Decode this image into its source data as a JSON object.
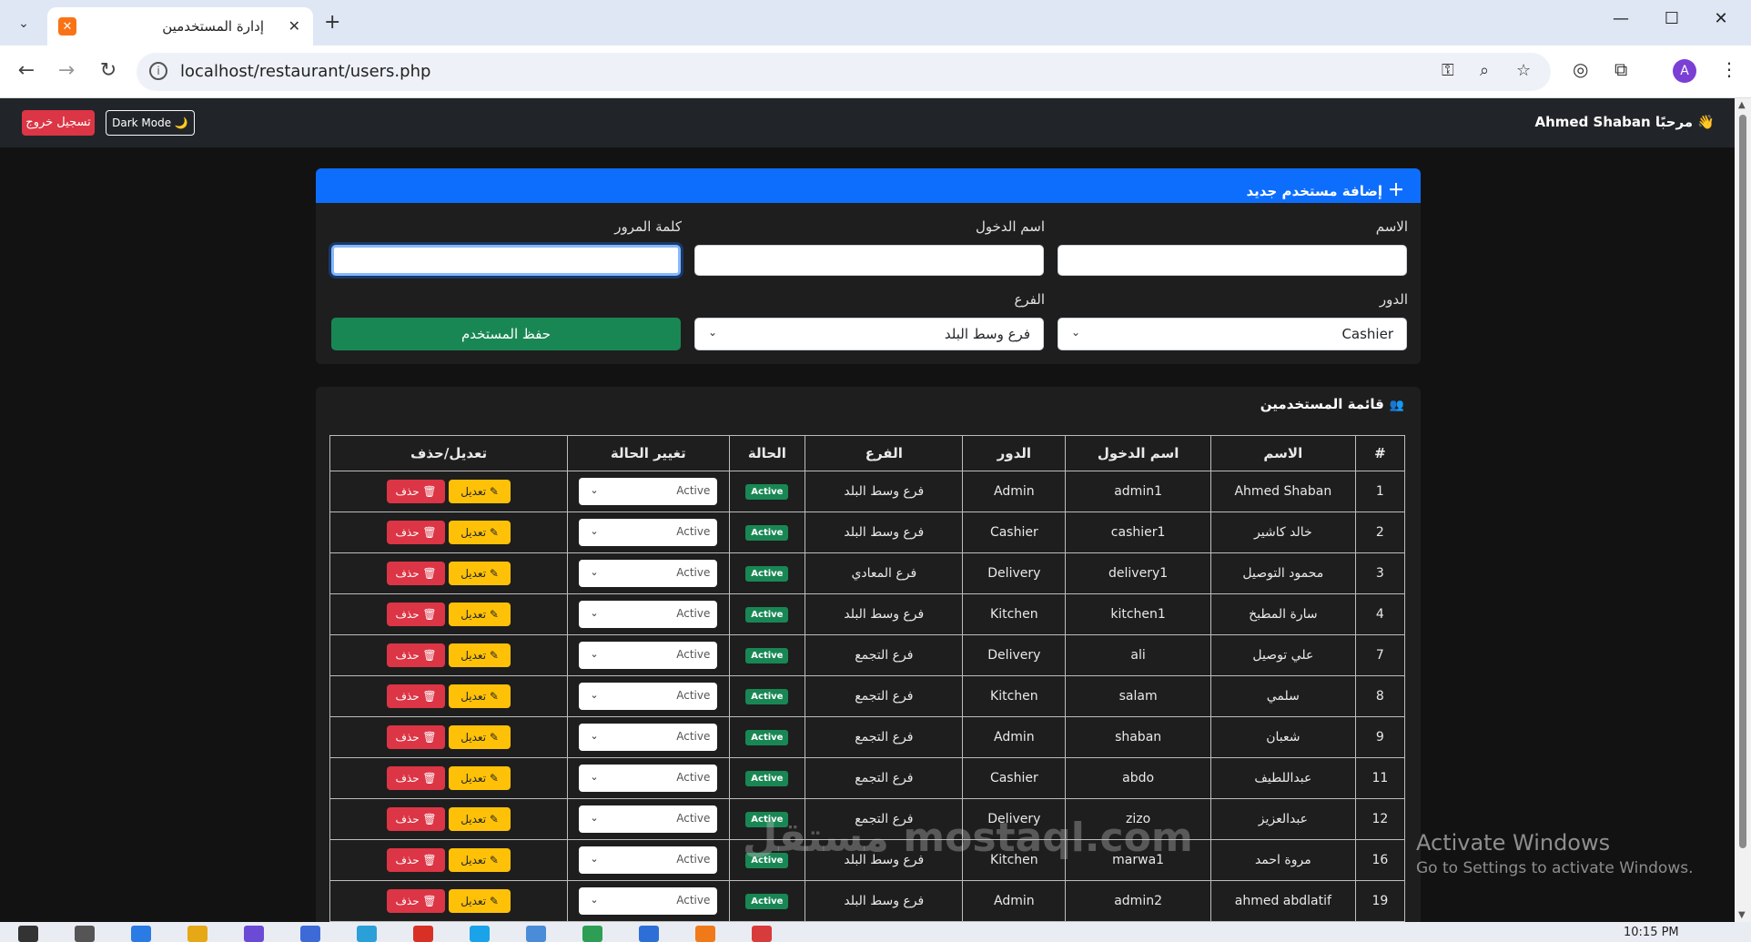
{
  "browser": {
    "tab_title": "إدارة المستخدمين",
    "url": "localhost/restaurant/users.php"
  },
  "navbar": {
    "welcome": "👋 مرحبًا Ahmed Shaban",
    "logout": "تسجيل خروج",
    "dark_mode": "Dark Mode 🌙"
  },
  "add_user": {
    "title": "إضافة مستخدم جديد",
    "labels": {
      "name": "الاسم",
      "username": "اسم الدخول",
      "password": "كلمة المرور",
      "role": "الدور",
      "branch": "الفرع"
    },
    "role_value": "Cashier",
    "branch_value": "فرع وسط البلد",
    "save_label": "حفظ المستخدم"
  },
  "users_list": {
    "title": "قائمة المستخدمين",
    "headers": [
      "#",
      "الاسم",
      "اسم الدخول",
      "الدور",
      "الفرع",
      "الحالة",
      "تغيير الحالة",
      "تعديل/حذف"
    ],
    "edit_label": "تعديل",
    "delete_label": "حذف",
    "rows": [
      {
        "id": "1",
        "name": "Ahmed Shaban",
        "username": "admin1",
        "role": "Admin",
        "branch": "فرع وسط البلد",
        "status": "Active",
        "select": "Active"
      },
      {
        "id": "2",
        "name": "خالد كاشير",
        "username": "cashier1",
        "role": "Cashier",
        "branch": "فرع وسط البلد",
        "status": "Active",
        "select": "Active"
      },
      {
        "id": "3",
        "name": "محمود التوصيل",
        "username": "delivery1",
        "role": "Delivery",
        "branch": "فرع المعادي",
        "status": "Active",
        "select": "Active"
      },
      {
        "id": "4",
        "name": "سارة المطبخ",
        "username": "kitchen1",
        "role": "Kitchen",
        "branch": "فرع وسط البلد",
        "status": "Active",
        "select": "Active"
      },
      {
        "id": "7",
        "name": "علي توصيل",
        "username": "ali",
        "role": "Delivery",
        "branch": "فرع التجمع",
        "status": "Active",
        "select": "Active"
      },
      {
        "id": "8",
        "name": "سلمي",
        "username": "salam",
        "role": "Kitchen",
        "branch": "فرع التجمع",
        "status": "Active",
        "select": "Active"
      },
      {
        "id": "9",
        "name": "شعبان",
        "username": "shaban",
        "role": "Admin",
        "branch": "فرع التجمع",
        "status": "Active",
        "select": "Active"
      },
      {
        "id": "11",
        "name": "عبداللطيف",
        "username": "abdo",
        "role": "Cashier",
        "branch": "فرع التجمع",
        "status": "Active",
        "select": "Active"
      },
      {
        "id": "12",
        "name": "عبدالعزيز",
        "username": "zizo",
        "role": "Delivery",
        "branch": "فرع التجمع",
        "status": "Active",
        "select": "Active"
      },
      {
        "id": "16",
        "name": "مروة احمد",
        "username": "marwa1",
        "role": "Kitchen",
        "branch": "فرع وسط البلد",
        "status": "Active",
        "select": "Active"
      },
      {
        "id": "19",
        "name": "ahmed abdlatif",
        "username": "admin2",
        "role": "Admin",
        "branch": "فرع وسط البلد",
        "status": "Active",
        "select": "Active"
      }
    ]
  },
  "os": {
    "activate_title": "Activate Windows",
    "activate_sub": "Go to Settings to activate Windows.",
    "watermark": "مستقل mostaql.com",
    "clock": "10:15 PM"
  }
}
